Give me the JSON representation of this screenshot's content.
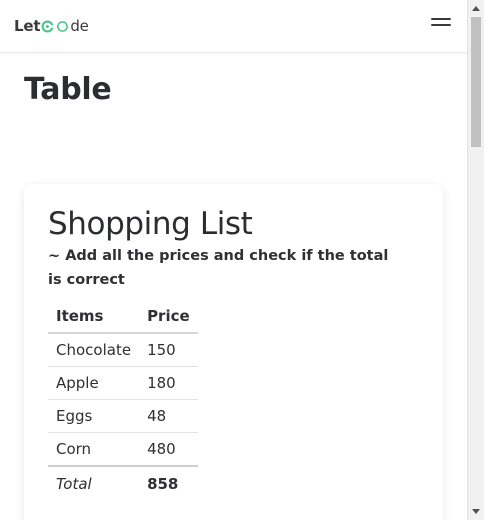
{
  "navbar": {
    "logo_part1": "Let",
    "logo_part2": "de",
    "logo_accent_color": "#43c585",
    "menu_icon": "hamburger-icon"
  },
  "page": {
    "title": "Table"
  },
  "card": {
    "title": "Shopping List",
    "subtitle": "~ Add all the prices and check if the total is correct"
  },
  "table": {
    "headers": [
      "Items",
      "Price"
    ],
    "rows": [
      {
        "item": "Chocolate",
        "price": "150"
      },
      {
        "item": "Apple",
        "price": "180"
      },
      {
        "item": "Eggs",
        "price": "48"
      },
      {
        "item": "Corn",
        "price": "480"
      }
    ],
    "footer": {
      "label": "Total",
      "value": "858"
    }
  },
  "scrollbar": {
    "position_fraction": 0.0
  }
}
